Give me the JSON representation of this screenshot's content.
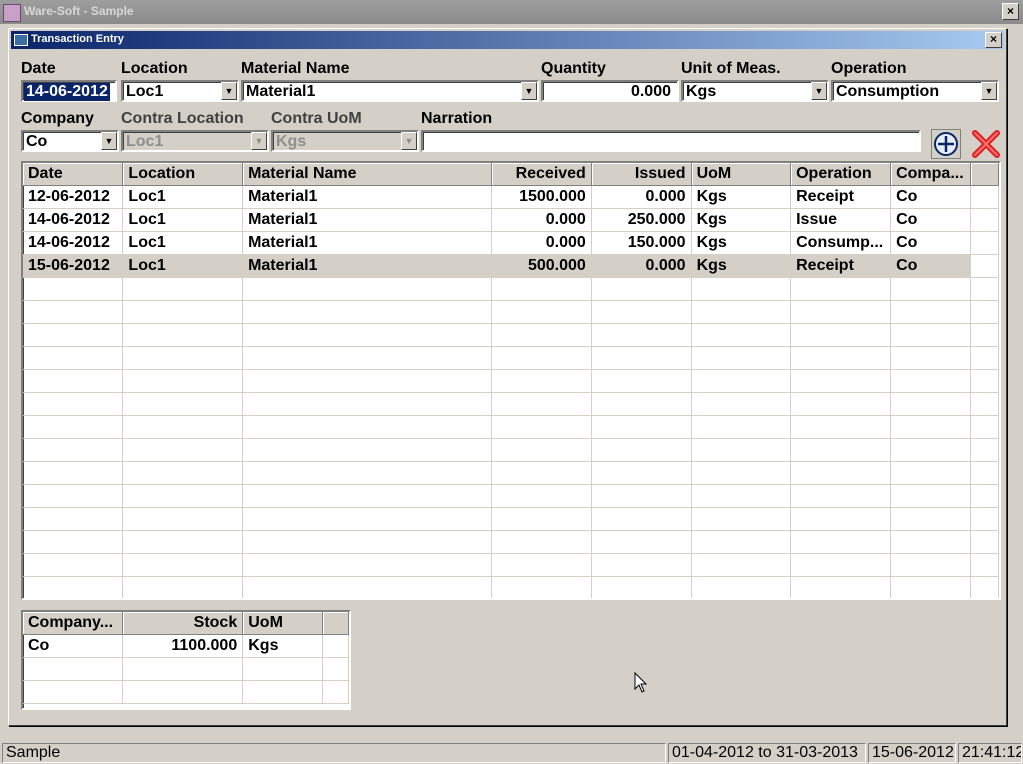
{
  "app": {
    "title": "Ware-Soft - Sample",
    "close": "×"
  },
  "dialog": {
    "title": "Transaction Entry",
    "close": "×"
  },
  "form": {
    "date": {
      "label": "Date",
      "value": "14-06-2012"
    },
    "location": {
      "label": "Location",
      "value": "Loc1"
    },
    "material": {
      "label": "Material Name",
      "value": "Material1"
    },
    "quantity": {
      "label": "Quantity",
      "value": "0.000"
    },
    "uom": {
      "label": "Unit of Meas.",
      "value": "Kgs"
    },
    "operation": {
      "label": "Operation",
      "value": "Consumption"
    },
    "company": {
      "label": "Company",
      "value": "Co"
    },
    "contra_location": {
      "label": "Contra Location",
      "value": "Loc1"
    },
    "contra_uom": {
      "label": "Contra UoM",
      "value": "Kgs"
    },
    "narration": {
      "label": "Narration",
      "value": ""
    },
    "dropdown_glyph": "▼"
  },
  "transactions": {
    "columns": [
      "Date",
      "Location",
      "Material Name",
      "Received",
      "Issued",
      "UoM",
      "Operation",
      "Compa..."
    ],
    "rows": [
      [
        "12-06-2012",
        "Loc1",
        "Material1",
        "1500.000",
        "0.000",
        "Kgs",
        "Receipt",
        "Co"
      ],
      [
        "14-06-2012",
        "Loc1",
        "Material1",
        "0.000",
        "250.000",
        "Kgs",
        "Issue",
        "Co"
      ],
      [
        "14-06-2012",
        "Loc1",
        "Material1",
        "0.000",
        "150.000",
        "Kgs",
        "Consump...",
        "Co"
      ],
      [
        "15-06-2012",
        "Loc1",
        "Material1",
        "500.000",
        "0.000",
        "Kgs",
        "Receipt",
        "Co"
      ]
    ],
    "selected_row": 3
  },
  "stock": {
    "columns": [
      "Company...",
      "Stock",
      "UoM"
    ],
    "rows": [
      [
        "Co",
        "1100.000",
        "Kgs"
      ]
    ]
  },
  "status": {
    "company": "Sample",
    "period": "01-04-2012 to 31-03-2013",
    "date": "15-06-2012",
    "time": "21:41:12"
  },
  "icons": {
    "add": "add-circle-icon",
    "delete": "red-x-delete-icon"
  },
  "colors": {
    "title_start": "#0a246a",
    "title_end": "#a6caf0",
    "face": "#d4d0c8",
    "delete_red": "#e02020"
  }
}
